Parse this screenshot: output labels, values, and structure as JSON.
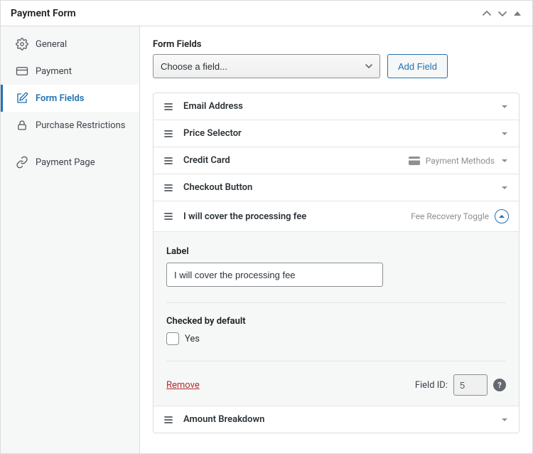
{
  "header": {
    "title": "Payment Form"
  },
  "sidebar": {
    "items": [
      {
        "label": "General"
      },
      {
        "label": "Payment"
      },
      {
        "label": "Form Fields"
      },
      {
        "label": "Purchase Restrictions"
      },
      {
        "label": "Payment Page"
      }
    ]
  },
  "main": {
    "section_label": "Form Fields",
    "select_placeholder": "Choose a field...",
    "add_button": "Add Field"
  },
  "fields": [
    {
      "title": "Email Address",
      "meta": ""
    },
    {
      "title": "Price Selector",
      "meta": ""
    },
    {
      "title": "Credit Card",
      "meta": "Payment Methods"
    },
    {
      "title": "Checkout Button",
      "meta": ""
    },
    {
      "title": "I will cover the processing fee",
      "meta": "Fee Recovery Toggle"
    },
    {
      "title": "Amount Breakdown",
      "meta": ""
    }
  ],
  "settings": {
    "label_heading": "Label",
    "label_value": "I will cover the processing fee",
    "checked_heading": "Checked by default",
    "checked_option": "Yes",
    "remove": "Remove",
    "field_id_label": "Field ID:",
    "field_id_value": "5"
  }
}
